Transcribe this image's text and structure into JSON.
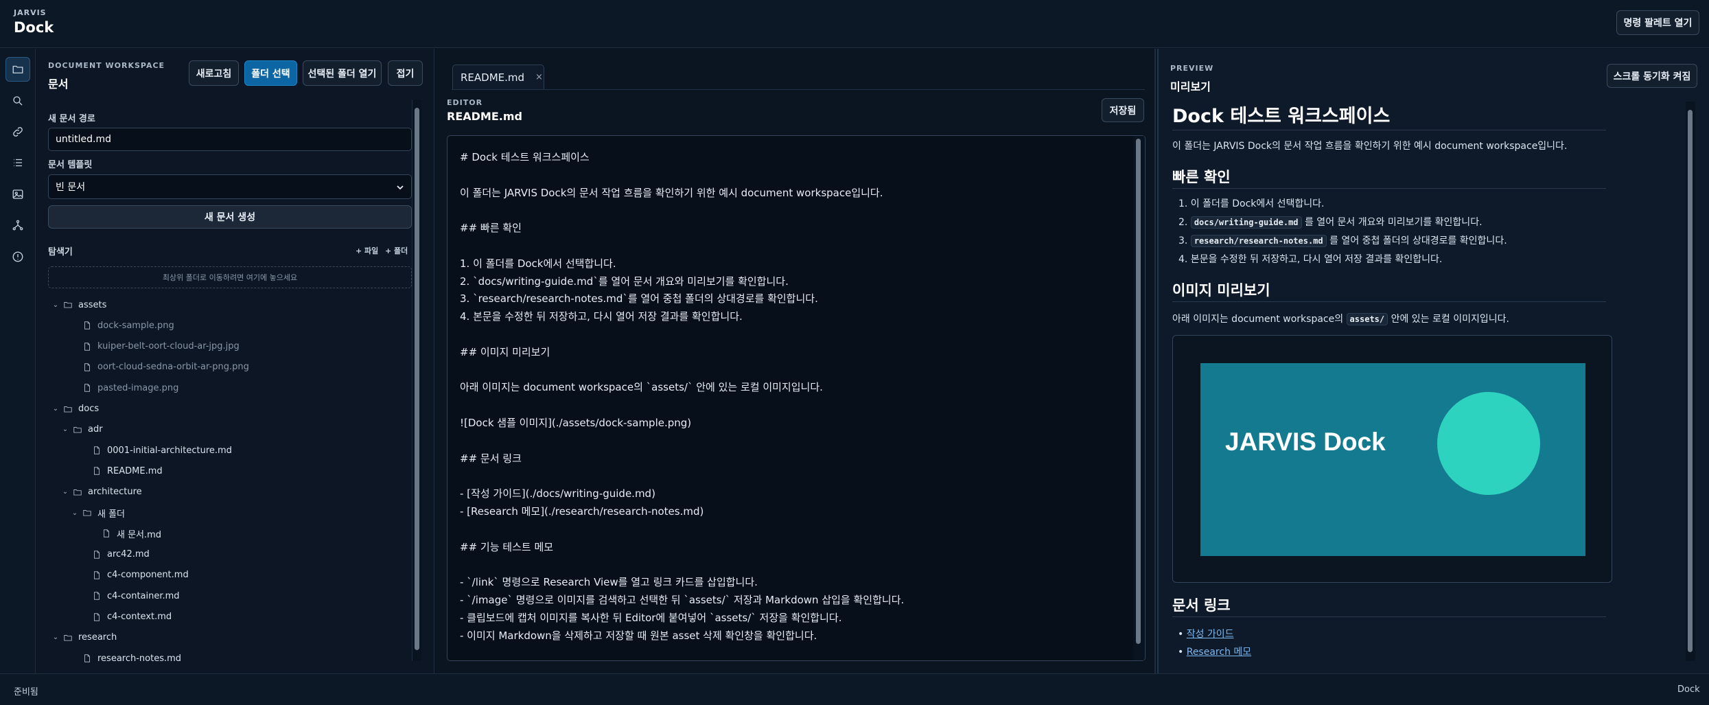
{
  "header": {
    "brand_sub": "JARVIS",
    "brand_title": "Dock",
    "command_palette_label": "명령 팔레트 열기"
  },
  "activity_bar": {
    "items": [
      {
        "icon": "folder-icon",
        "active": true
      },
      {
        "icon": "search-icon",
        "active": false
      },
      {
        "icon": "link-icon",
        "active": false
      },
      {
        "icon": "list-icon",
        "active": false
      },
      {
        "icon": "image-icon",
        "active": false
      },
      {
        "icon": "graph-icon",
        "active": false
      },
      {
        "icon": "alert-icon",
        "active": false
      }
    ]
  },
  "explorer": {
    "section_label": "DOCUMENT WORKSPACE",
    "section_title": "문서",
    "buttons": {
      "refresh": "새로고침",
      "select_folder": "폴더 선택",
      "open_selected": "선택된 폴더 열기",
      "collapse": "접기"
    },
    "new_doc_path_label": "새 문서 경로",
    "new_doc_path_value": "untitled.md",
    "template_label": "문서 템플릿",
    "template_value": "빈 문서",
    "create_button": "새 문서 생성",
    "tree_label": "탐색기",
    "add_file": "+ 파일",
    "add_folder": "+ 폴더",
    "drop_zone": "최상위 폴더로 이동하려면 여기에 놓으세요",
    "tree": [
      {
        "label": "assets",
        "type": "folder",
        "depth": 0
      },
      {
        "label": "dock-sample.png",
        "type": "file",
        "depth": 1
      },
      {
        "label": "kuiper-belt-oort-cloud-ar-jpg.jpg",
        "type": "file",
        "depth": 1
      },
      {
        "label": "oort-cloud-sedna-orbit-ar-png.png",
        "type": "file",
        "depth": 1
      },
      {
        "label": "pasted-image.png",
        "type": "file",
        "depth": 1
      },
      {
        "label": "docs",
        "type": "folder",
        "depth": 0
      },
      {
        "label": "adr",
        "type": "folder",
        "depth": 1
      },
      {
        "label": "0001-initial-architecture.md",
        "type": "md",
        "depth": 2
      },
      {
        "label": "README.md",
        "type": "md",
        "depth": 2
      },
      {
        "label": "architecture",
        "type": "folder",
        "depth": 1
      },
      {
        "label": "새 폴더",
        "type": "folder",
        "depth": 2
      },
      {
        "label": "새 문서.md",
        "type": "md",
        "depth": 3
      },
      {
        "label": "arc42.md",
        "type": "md",
        "depth": 2
      },
      {
        "label": "c4-component.md",
        "type": "md",
        "depth": 2
      },
      {
        "label": "c4-container.md",
        "type": "md",
        "depth": 2
      },
      {
        "label": "c4-context.md",
        "type": "md",
        "depth": 2
      },
      {
        "label": "research",
        "type": "folder",
        "depth": 0
      },
      {
        "label": "research-notes.md",
        "type": "md",
        "depth": 1
      }
    ]
  },
  "editor": {
    "tab_label": "README.md",
    "section_label": "EDITOR",
    "file_title": "README.md",
    "saved_label": "저장됨",
    "lines": [
      "# Dock 테스트 워크스페이스",
      "",
      "이 폴더는 JARVIS Dock의 문서 작업 흐름을 확인하기 위한 예시 document workspace입니다.",
      "",
      "## 빠른 확인",
      "",
      "1. 이 폴더를 Dock에서 선택합니다.",
      "2. `docs/writing-guide.md`를 열어 문서 개요와 미리보기를 확인합니다.",
      "3. `research/research-notes.md`를 열어 중첩 폴더의 상대경로를 확인합니다.",
      "4. 본문을 수정한 뒤 저장하고, 다시 열어 저장 결과를 확인합니다.",
      "",
      "## 이미지 미리보기",
      "",
      "아래 이미지는 document workspace의 `assets/` 안에 있는 로컬 이미지입니다.",
      "",
      "![Dock 샘플 이미지](./assets/dock-sample.png)",
      "",
      "## 문서 링크",
      "",
      "- [작성 가이드](./docs/writing-guide.md)",
      "- [Research 메모](./research/research-notes.md)",
      "",
      "## 기능 테스트 메모",
      "",
      "- `/link` 명령으로 Research View를 열고 링크 카드를 삽입합니다.",
      "- `/image` 명령으로 이미지를 검색하고 선택한 뒤 `assets/` 저장과 Markdown 삽입을 확인합니다.",
      "- 클립보드에 캡처 이미지를 복사한 뒤 Editor에 붙여넣어 `assets/` 저장을 확인합니다.",
      "- 이미지 Markdown을 삭제하고 저장할 때 원본 asset 삭제 확인창을 확인합니다."
    ]
  },
  "preview": {
    "section_label": "PREVIEW",
    "section_title": "미리보기",
    "sync_scroll_label": "스크롤 동기화 켜짐",
    "h1": "Dock 테스트 워크스페이스",
    "intro": "이 폴더는 JARVIS Dock의 문서 작업 흐름을 확인하기 위한 예시 document workspace입니다.",
    "quick_heading": "빠른 확인",
    "quick_items": [
      {
        "pre": "1. 이 폴더를 Dock에서 선택합니다.",
        "code": "",
        "post": ""
      },
      {
        "pre": "2. ",
        "code": "docs/writing-guide.md",
        "post": " 를 열어 문서 개요와 미리보기를 확인합니다."
      },
      {
        "pre": "3. ",
        "code": "research/research-notes.md",
        "post": " 를 열어 중첩 폴더의 상대경로를 확인합니다."
      },
      {
        "pre": "4. 본문을 수정한 뒤 저장하고, 다시 열어 저장 결과를 확인합니다.",
        "code": "",
        "post": ""
      }
    ],
    "image_heading": "이미지 미리보기",
    "image_text_pre": "아래 이미지는 document workspace의 ",
    "image_text_code": "assets/",
    "image_text_post": " 안에 있는 로컬 이미지입니다.",
    "image_caption_text": "JARVIS Dock",
    "image_bg_color": "#137a8f",
    "image_circle_color": "#2ed3c0",
    "links_heading": "문서 링크",
    "links": [
      "작성 가이드",
      "Research 메모"
    ]
  },
  "status": {
    "left": "준비됨",
    "right": "Dock"
  }
}
